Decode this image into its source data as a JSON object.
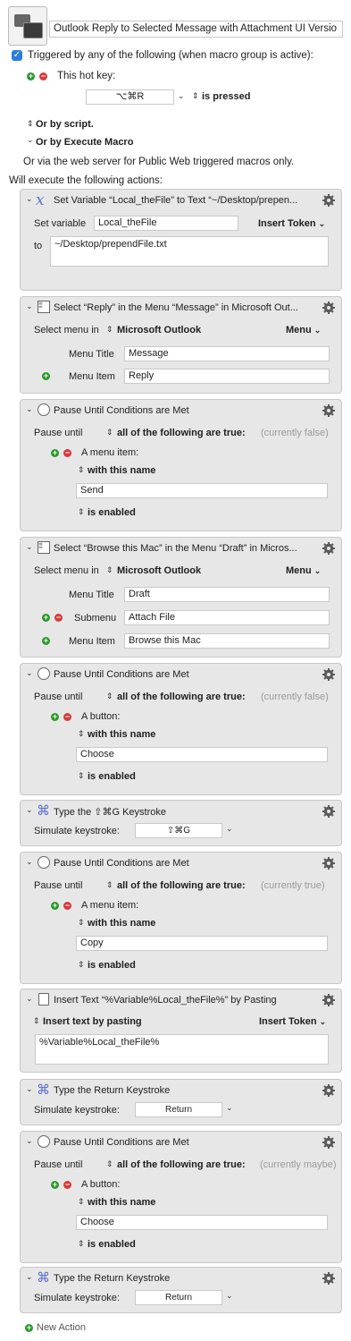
{
  "macro_title": "Outlook Reply to Selected Message with Attachment UI Versio",
  "trigger": {
    "checkbox_label": "Triggered by any of the following (when macro group is active):",
    "hotkey_label": "This hot key:",
    "hotkey_value": "⌥⌘R",
    "hotkey_state": "is pressed",
    "or_script": "Or by script.",
    "or_execute": "Or by Execute Macro",
    "web_server": "Or via the web server for Public Web triggered macros only.",
    "will_execute": "Will execute the following actions:"
  },
  "actions": {
    "a1": {
      "title": "Set Variable “Local_theFile” to Text “~/Desktop/prepen...",
      "set_variable_label": "Set variable",
      "variable_name": "Local_theFile",
      "insert_token": "Insert Token",
      "to_label": "to",
      "text": "~/Desktop/prependFile.txt"
    },
    "a2": {
      "title": "Select “Reply” in the Menu “Message” in Microsoft Out...",
      "select_menu_in": "Select menu in",
      "app": "Microsoft Outlook",
      "menu_btn": "Menu",
      "menu_title_label": "Menu Title",
      "menu_title": "Message",
      "menu_item_label": "Menu Item",
      "menu_item": "Reply"
    },
    "a3": {
      "title": "Pause Until Conditions are Met",
      "pause_until": "Pause until",
      "condition_mode": "all of the following are true:",
      "status": "(currently false)",
      "cond_type": "A menu item:",
      "with_name": "with this name",
      "name_value": "Send",
      "enabled": "is enabled"
    },
    "a4": {
      "title": "Select “Browse this Mac” in the Menu “Draft” in Micros...",
      "select_menu_in": "Select menu in",
      "app": "Microsoft Outlook",
      "menu_btn": "Menu",
      "menu_title_label": "Menu Title",
      "menu_title": "Draft",
      "submenu_label": "Submenu",
      "submenu": "Attach File",
      "menu_item_label": "Menu Item",
      "menu_item": "Browse this Mac"
    },
    "a5": {
      "title": "Pause Until Conditions are Met",
      "pause_until": "Pause until",
      "condition_mode": "all of the following are true:",
      "status": "(currently false)",
      "cond_type": "A button:",
      "with_name": "with this name",
      "name_value": "Choose",
      "enabled": "is enabled"
    },
    "a6": {
      "title": "Type the ⇧⌘G Keystroke",
      "simulate_label": "Simulate keystroke:",
      "keystroke": "⇧⌘G"
    },
    "a7": {
      "title": "Pause Until Conditions are Met",
      "pause_until": "Pause until",
      "condition_mode": "all of the following are true:",
      "status": "(currently true)",
      "cond_type": "A menu item:",
      "with_name": "with this name",
      "name_value": "Copy",
      "enabled": "is enabled"
    },
    "a8": {
      "title": "Insert Text “%Variable%Local_theFile%” by Pasting",
      "mode": "Insert text by pasting",
      "insert_token": "Insert Token",
      "text": "%Variable%Local_theFile%"
    },
    "a9": {
      "title": "Type the Return Keystroke",
      "simulate_label": "Simulate keystroke:",
      "keystroke": "Return"
    },
    "a10": {
      "title": "Pause Until Conditions are Met",
      "pause_until": "Pause until",
      "condition_mode": "all of the following are true:",
      "status": "(currently maybe)",
      "cond_type": "A button:",
      "with_name": "with this name",
      "name_value": "Choose",
      "enabled": "is enabled"
    },
    "a11": {
      "title": "Type the Return Keystroke",
      "simulate_label": "Simulate keystroke:",
      "keystroke": "Return"
    }
  },
  "new_action": "New Action",
  "colors": {
    "panel_bg": "#e7e7e7",
    "accent": "#2d7de0",
    "plus_green": "#2a9a2a",
    "minus_red": "#d83a3a"
  }
}
